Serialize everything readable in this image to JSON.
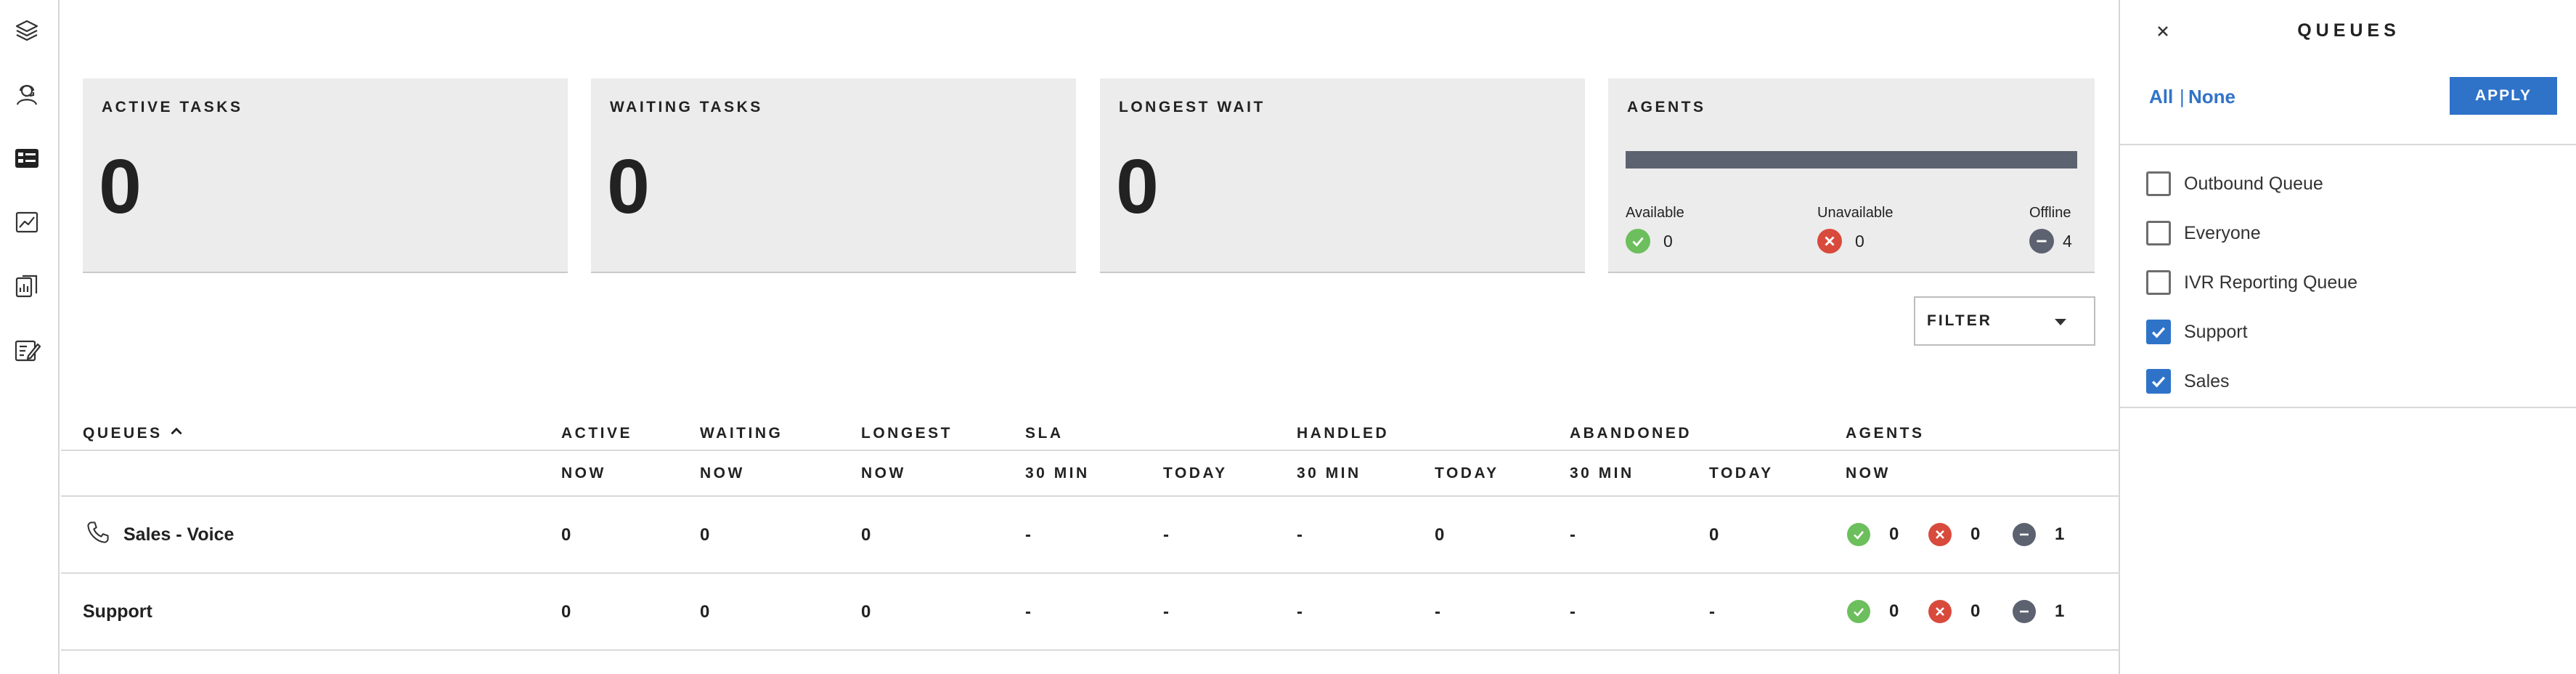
{
  "rail": {
    "icons": [
      "layers-icon",
      "user-headset-icon",
      "dashboard-icon",
      "trend-chart-icon",
      "report-icon",
      "edit-form-icon"
    ]
  },
  "cards": {
    "active_tasks": {
      "title": "ACTIVE TASKS",
      "value": "0"
    },
    "waiting_tasks": {
      "title": "WAITING TASKS",
      "value": "0"
    },
    "longest_wait": {
      "title": "LONGEST WAIT",
      "value": "0"
    },
    "agents": {
      "title": "AGENTS",
      "available_label": "Available",
      "available": "0",
      "unavailable_label": "Unavailable",
      "unavailable": "0",
      "offline_label": "Offline",
      "offline": "4"
    }
  },
  "filter": {
    "label": "FILTER"
  },
  "table": {
    "headers": {
      "queues": "QUEUES",
      "active": "ACTIVE",
      "waiting": "WAITING",
      "longest": "LONGEST",
      "sla": "SLA",
      "handled": "HANDLED",
      "abandoned": "ABANDONED",
      "agents": "AGENTS"
    },
    "subheaders": {
      "active": "NOW",
      "waiting": "NOW",
      "longest": "NOW",
      "sla_30": "30 MIN",
      "sla_today": "TODAY",
      "handled_30": "30 MIN",
      "handled_today": "TODAY",
      "abandoned_30": "30 MIN",
      "abandoned_today": "TODAY",
      "agents": "NOW"
    },
    "rows": [
      {
        "name": "Sales - Voice",
        "active": "0",
        "waiting": "0",
        "longest": "0",
        "sla_30": "-",
        "sla_today": "-",
        "handled_30": "-",
        "handled_today": "0",
        "abandoned_30": "-",
        "abandoned_today": "0",
        "agents_available": "0",
        "agents_unavailable": "0",
        "agents_offline": "1"
      },
      {
        "name": "Support",
        "active": "0",
        "waiting": "0",
        "longest": "0",
        "sla_30": "-",
        "sla_today": "-",
        "handled_30": "-",
        "handled_today": "-",
        "abandoned_30": "-",
        "abandoned_today": "-",
        "agents_available": "0",
        "agents_unavailable": "0",
        "agents_offline": "1"
      }
    ]
  },
  "panel": {
    "title": "QUEUES",
    "all_label": "All",
    "separator": "|",
    "none_label": "None",
    "apply_label": "APPLY",
    "options": [
      {
        "label": "Outbound Queue",
        "checked": false
      },
      {
        "label": "Everyone",
        "checked": false
      },
      {
        "label": "IVR Reporting Queue",
        "checked": false
      },
      {
        "label": "Support",
        "checked": true
      },
      {
        "label": "Sales",
        "checked": true
      }
    ]
  },
  "colors": {
    "accent": "#2f73c9",
    "available": "#6cbf5c",
    "unavailable": "#d84a3c",
    "offline": "#5d6270",
    "card_bg": "#ececec"
  }
}
